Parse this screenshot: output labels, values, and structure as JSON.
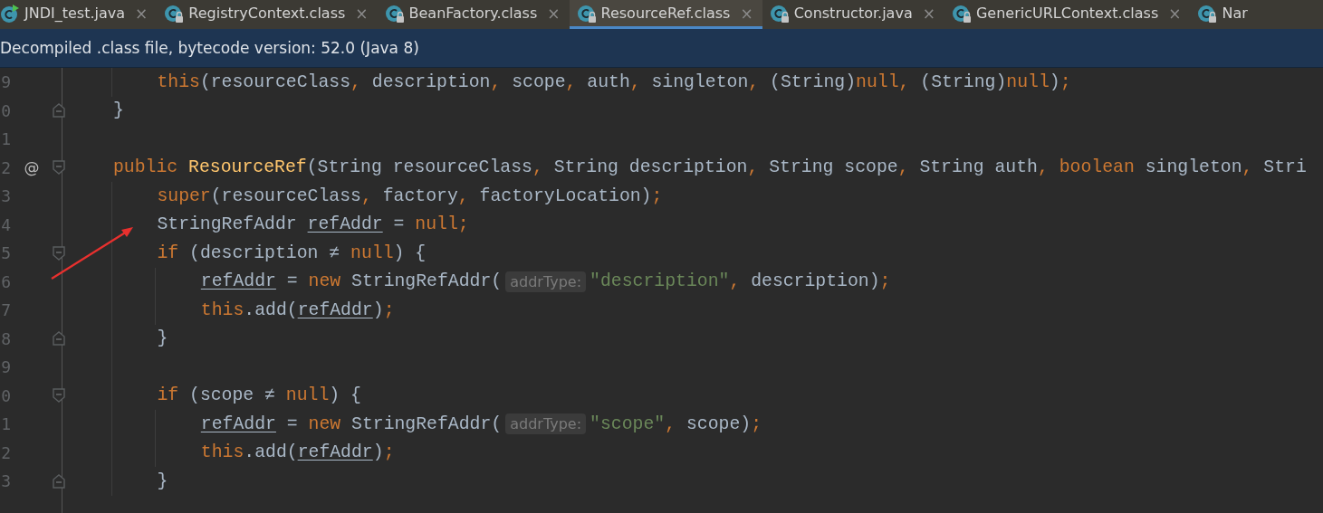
{
  "tabs": [
    {
      "label": "JNDI_test.java",
      "kind": "runnable",
      "selected": false
    },
    {
      "label": "RegistryContext.class",
      "kind": "locked-class",
      "selected": false
    },
    {
      "label": "BeanFactory.class",
      "kind": "locked-class",
      "selected": false
    },
    {
      "label": "ResourceRef.class",
      "kind": "locked-class",
      "selected": true
    },
    {
      "label": "Constructor.java",
      "kind": "locked-class",
      "selected": false
    },
    {
      "label": "GenericURLContext.class",
      "kind": "locked-class",
      "selected": false
    },
    {
      "label": "Nar",
      "kind": "locked-class",
      "selected": false
    }
  ],
  "close_glyph": "×",
  "info_bar": {
    "text": "Decompiled .class file, bytecode version: 52.0 (Java 8)"
  },
  "lines": [
    {
      "children": [
        {
          "number": "9",
          "tokens": [
            {
              "t": "this",
              "kind": "kw"
            },
            {
              "t": "(resourceClass",
              "kind": "p"
            },
            {
              "t": ", ",
              "kind": "o"
            },
            {
              "t": "description",
              "kind": "p"
            },
            {
              "t": ", ",
              "kind": "o"
            },
            {
              "t": "scope",
              "kind": "p"
            },
            {
              "t": ", ",
              "kind": "o"
            },
            {
              "t": "auth",
              "kind": "p"
            },
            {
              "t": ", ",
              "kind": "o"
            },
            {
              "t": "singleton",
              "kind": "p"
            },
            {
              "t": ", ",
              "kind": "o"
            },
            {
              "t": "(String)",
              "kind": "p"
            },
            {
              "t": "null",
              "kind": "kw"
            },
            {
              "t": ", ",
              "kind": "o"
            },
            {
              "t": "(String)",
              "kind": "p"
            },
            {
              "t": "null",
              "kind": "kw"
            },
            {
              "t": ")",
              "kind": "p"
            },
            {
              "t": ";",
              "kind": "o"
            }
          ]
        }
      ]
    },
    {
      "number": "0",
      "kind": "fold-end",
      "tokens": [
        {
          "t": "}",
          "kind": "p"
        }
      ]
    },
    {
      "number": "1"
    },
    {
      "number": "2",
      "annotation": "@",
      "kind": "fold-start",
      "tokens": [
        {
          "t": "public ",
          "kind": "kw"
        },
        {
          "t": "ResourceRef",
          "kind": "fn"
        },
        {
          "t": "(String resourceClass",
          "kind": "p"
        },
        {
          "t": ", ",
          "kind": "o"
        },
        {
          "t": "String description",
          "kind": "p"
        },
        {
          "t": ", ",
          "kind": "o"
        },
        {
          "t": "String scope",
          "kind": "p"
        },
        {
          "t": ", ",
          "kind": "o"
        },
        {
          "t": "String auth",
          "kind": "p"
        },
        {
          "t": ", ",
          "kind": "o"
        },
        {
          "t": "boolean ",
          "kind": "kw"
        },
        {
          "t": "singleton",
          "kind": "p"
        },
        {
          "t": ", ",
          "kind": "o"
        },
        {
          "t": "Stri",
          "kind": "p"
        }
      ],
      "children": [
        {
          "number": "3",
          "tokens": [
            {
              "t": "super",
              "kind": "kw"
            },
            {
              "t": "(resourceClass",
              "kind": "p"
            },
            {
              "t": ", ",
              "kind": "o"
            },
            {
              "t": "factory",
              "kind": "p"
            },
            {
              "t": ", ",
              "kind": "o"
            },
            {
              "t": "factoryLocation)",
              "kind": "p"
            },
            {
              "t": ";",
              "kind": "o"
            }
          ]
        },
        {
          "number": "4",
          "tokens": [
            {
              "t": "StringRefAddr ",
              "kind": "p"
            },
            {
              "t": "refAddr",
              "kind": "var"
            },
            {
              "t": " = ",
              "kind": "p"
            },
            {
              "t": "null",
              "kind": "kw"
            },
            {
              "t": ";",
              "kind": "o"
            }
          ]
        },
        {
          "number": "5",
          "kind": "fold-start",
          "tokens": [
            {
              "t": "if",
              "kind": "kw"
            },
            {
              "t": " (description ≠ ",
              "kind": "p"
            },
            {
              "t": "null",
              "kind": "kw"
            },
            {
              "t": ") {",
              "kind": "p"
            }
          ],
          "children": [
            {
              "number": "6",
              "tokens": [
                {
                  "t": "refAddr",
                  "kind": "var"
                },
                {
                  "t": " = ",
                  "kind": "p"
                },
                {
                  "t": "new ",
                  "kind": "kw"
                },
                {
                  "t": "StringRefAddr(",
                  "kind": "p"
                },
                {
                  "t": "addrType:",
                  "kind": "hint"
                },
                {
                  "t": "\"description\"",
                  "kind": "str"
                },
                {
                  "t": ", ",
                  "kind": "o"
                },
                {
                  "t": "description)",
                  "kind": "p"
                },
                {
                  "t": ";",
                  "kind": "o"
                }
              ]
            },
            {
              "number": "7",
              "tokens": [
                {
                  "t": "this",
                  "kind": "kw"
                },
                {
                  "t": ".add(",
                  "kind": "p"
                },
                {
                  "t": "refAddr",
                  "kind": "var"
                },
                {
                  "t": ")",
                  "kind": "p"
                },
                {
                  "t": ";",
                  "kind": "o"
                }
              ]
            }
          ]
        },
        {
          "number": "8",
          "kind": "fold-end",
          "tokens": [
            {
              "t": "}",
              "kind": "p"
            }
          ]
        },
        {
          "number": "9"
        },
        {
          "number": "0",
          "kind": "fold-start",
          "tokens": [
            {
              "t": "if",
              "kind": "kw"
            },
            {
              "t": " (scope ≠ ",
              "kind": "p"
            },
            {
              "t": "null",
              "kind": "kw"
            },
            {
              "t": ") {",
              "kind": "p"
            }
          ],
          "children": [
            {
              "number": "1",
              "tokens": [
                {
                  "t": "refAddr",
                  "kind": "var"
                },
                {
                  "t": " = ",
                  "kind": "p"
                },
                {
                  "t": "new ",
                  "kind": "kw"
                },
                {
                  "t": "StringRefAddr(",
                  "kind": "p"
                },
                {
                  "t": "addrType:",
                  "kind": "hint"
                },
                {
                  "t": "\"scope\"",
                  "kind": "str"
                },
                {
                  "t": ", ",
                  "kind": "o"
                },
                {
                  "t": "scope)",
                  "kind": "p"
                },
                {
                  "t": ";",
                  "kind": "o"
                }
              ]
            },
            {
              "number": "2",
              "tokens": [
                {
                  "t": "this",
                  "kind": "kw"
                },
                {
                  "t": ".add(",
                  "kind": "p"
                },
                {
                  "t": "refAddr",
                  "kind": "var"
                },
                {
                  "t": ")",
                  "kind": "p"
                },
                {
                  "t": ";",
                  "kind": "o"
                }
              ]
            }
          ]
        },
        {
          "number": "3",
          "kind": "fold-end",
          "tokens": [
            {
              "t": "}",
              "kind": "p"
            }
          ]
        }
      ]
    }
  ]
}
